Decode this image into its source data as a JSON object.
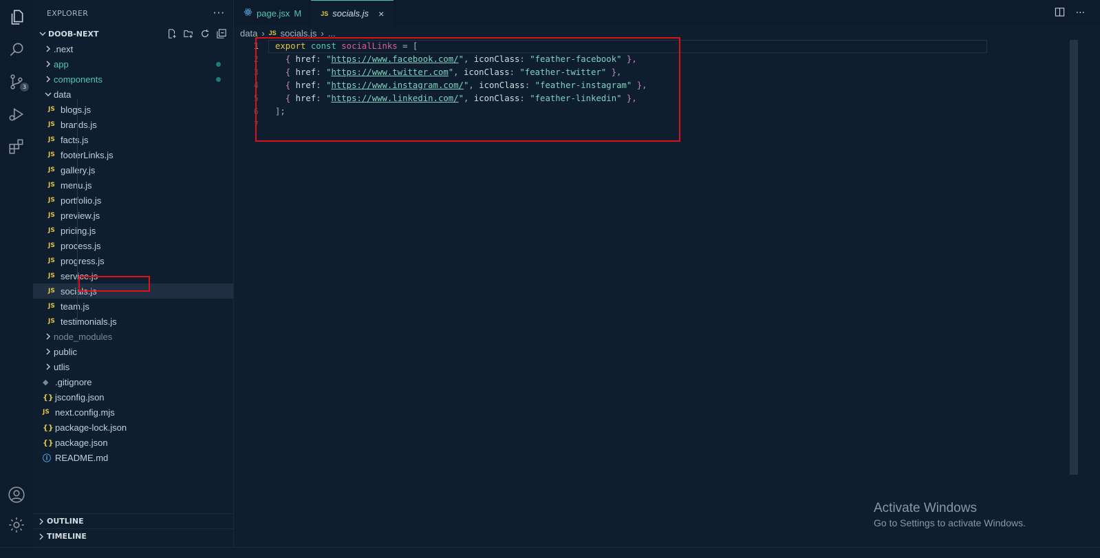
{
  "sidebar": {
    "title": "EXPLORER",
    "more_label": "···",
    "root": "DOOB-NEXT",
    "items": [
      {
        "label": ".next",
        "kind": "folder",
        "state": "collapsed"
      },
      {
        "label": "app",
        "kind": "folder",
        "state": "collapsed",
        "modified": true
      },
      {
        "label": "components",
        "kind": "folder",
        "state": "collapsed",
        "modified": true
      },
      {
        "label": "data",
        "kind": "folder",
        "state": "expanded"
      },
      {
        "label": "blogs.js",
        "kind": "js"
      },
      {
        "label": "brands.js",
        "kind": "js"
      },
      {
        "label": "facts.js",
        "kind": "js"
      },
      {
        "label": "footerLinks.js",
        "kind": "js"
      },
      {
        "label": "gallery.js",
        "kind": "js"
      },
      {
        "label": "menu.js",
        "kind": "js"
      },
      {
        "label": "portfolio.js",
        "kind": "js"
      },
      {
        "label": "preview.js",
        "kind": "js"
      },
      {
        "label": "pricing.js",
        "kind": "js"
      },
      {
        "label": "process.js",
        "kind": "js"
      },
      {
        "label": "progress.js",
        "kind": "js"
      },
      {
        "label": "service.js",
        "kind": "js"
      },
      {
        "label": "socials.js",
        "kind": "js",
        "selected": true
      },
      {
        "label": "team.js",
        "kind": "js"
      },
      {
        "label": "testimonials.js",
        "kind": "js"
      },
      {
        "label": "node_modules",
        "kind": "folder",
        "state": "collapsed",
        "dim": true
      },
      {
        "label": "public",
        "kind": "folder",
        "state": "collapsed"
      },
      {
        "label": "utlis",
        "kind": "folder",
        "state": "collapsed"
      },
      {
        "label": ".gitignore",
        "kind": "git"
      },
      {
        "label": "jsconfig.json",
        "kind": "json"
      },
      {
        "label": "next.config.mjs",
        "kind": "js"
      },
      {
        "label": "package-lock.json",
        "kind": "json"
      },
      {
        "label": "package.json",
        "kind": "json"
      },
      {
        "label": "README.md",
        "kind": "info"
      }
    ],
    "outline_label": "OUTLINE",
    "timeline_label": "TIMELINE"
  },
  "activity_bar": {
    "icons": [
      "files-icon",
      "search-icon",
      "source-control-icon",
      "run-debug-icon",
      "extensions-icon",
      "account-icon",
      "settings-gear-icon"
    ],
    "scm_badge": "3"
  },
  "tabs": [
    {
      "label": "page.jsx",
      "suffix": "M",
      "icon": "react-icon",
      "active": false
    },
    {
      "label": "socials.js",
      "icon": "JS",
      "active": true,
      "close": "×"
    }
  ],
  "breadcrumb": {
    "folder": "data",
    "file": "socials.js",
    "symbol": "..."
  },
  "file_icon_label": "JS",
  "json_icon_label": "{}",
  "editor": {
    "line_numbers": [
      "1",
      "2",
      "3",
      "4",
      "5",
      "6",
      "7"
    ],
    "lines": [
      {
        "t1": "export",
        "t2": "const",
        "t3": "socialLinks",
        "t4": "= ["
      },
      {
        "url": "https://www.facebook.com/",
        "cls": "feather-facebook"
      },
      {
        "url": "https://www.twitter.com",
        "cls": "feather-twitter"
      },
      {
        "url": "https://www.instagram.com/",
        "cls": "feather-instagram"
      },
      {
        "url": "https://www.linkedin.com/",
        "cls": "feather-linkedin"
      },
      {
        "close": "];"
      }
    ],
    "tokens": {
      "open": "{ ",
      "href": "href",
      "colon": ": ",
      "quote": "\"",
      "comma": ", ",
      "iconClass": "iconClass",
      "close": " },"
    }
  },
  "watermark": {
    "title": "Activate Windows",
    "subtitle": "Go to Settings to activate Windows."
  },
  "colors": {
    "background": "#0f1e2e",
    "accent": "#4ec9b0",
    "highlight_box": "#e0101a",
    "js_icon": "#e2c443"
  }
}
